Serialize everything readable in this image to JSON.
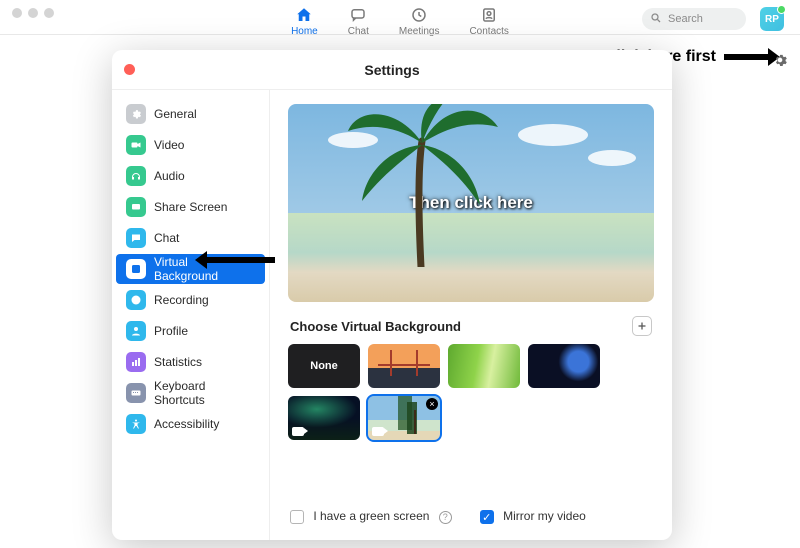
{
  "window_dots": true,
  "topnav": {
    "items": [
      {
        "label": "Home",
        "active": true
      },
      {
        "label": "Chat",
        "active": false
      },
      {
        "label": "Meetings",
        "active": false
      },
      {
        "label": "Contacts",
        "active": false
      }
    ]
  },
  "search": {
    "placeholder": "Search"
  },
  "avatar": {
    "initials": "RP",
    "status": "online"
  },
  "annotation": {
    "gear_label": "Click here first",
    "preview_label": "Then click here"
  },
  "settings": {
    "title": "Settings",
    "sidebar": {
      "items": [
        {
          "label": "General",
          "color": "#c9ccd0",
          "icon": "gear"
        },
        {
          "label": "Video",
          "color": "#36c98f",
          "icon": "video"
        },
        {
          "label": "Audio",
          "color": "#36c98f",
          "icon": "headphones"
        },
        {
          "label": "Share Screen",
          "color": "#36c98f",
          "icon": "share"
        },
        {
          "label": "Chat",
          "color": "#2fb8ec",
          "icon": "chat"
        },
        {
          "label": "Virtual Background",
          "color": "#0e71eb",
          "icon": "person",
          "active": true
        },
        {
          "label": "Recording",
          "color": "#2fb8ec",
          "icon": "record"
        },
        {
          "label": "Profile",
          "color": "#2fb8ec",
          "icon": "profile"
        },
        {
          "label": "Statistics",
          "color": "#9a6cf0",
          "icon": "stats"
        },
        {
          "label": "Keyboard Shortcuts",
          "color": "#8893ad",
          "icon": "keyboard"
        },
        {
          "label": "Accessibility",
          "color": "#2fb8ec",
          "icon": "accessibility"
        }
      ]
    },
    "choose_heading": "Choose Virtual Background",
    "thumbs": [
      {
        "kind": "none",
        "label": "None"
      },
      {
        "kind": "bridge"
      },
      {
        "kind": "grass"
      },
      {
        "kind": "earth"
      },
      {
        "kind": "aurora",
        "has_camera_badge": true
      },
      {
        "kind": "beach",
        "has_camera_badge": true,
        "selected": true,
        "deletable": true
      }
    ],
    "footer": {
      "green_screen_label": "I have a green screen",
      "green_screen_checked": false,
      "mirror_label": "Mirror my video",
      "mirror_checked": true
    }
  },
  "colors": {
    "accent": "#0e71eb"
  }
}
